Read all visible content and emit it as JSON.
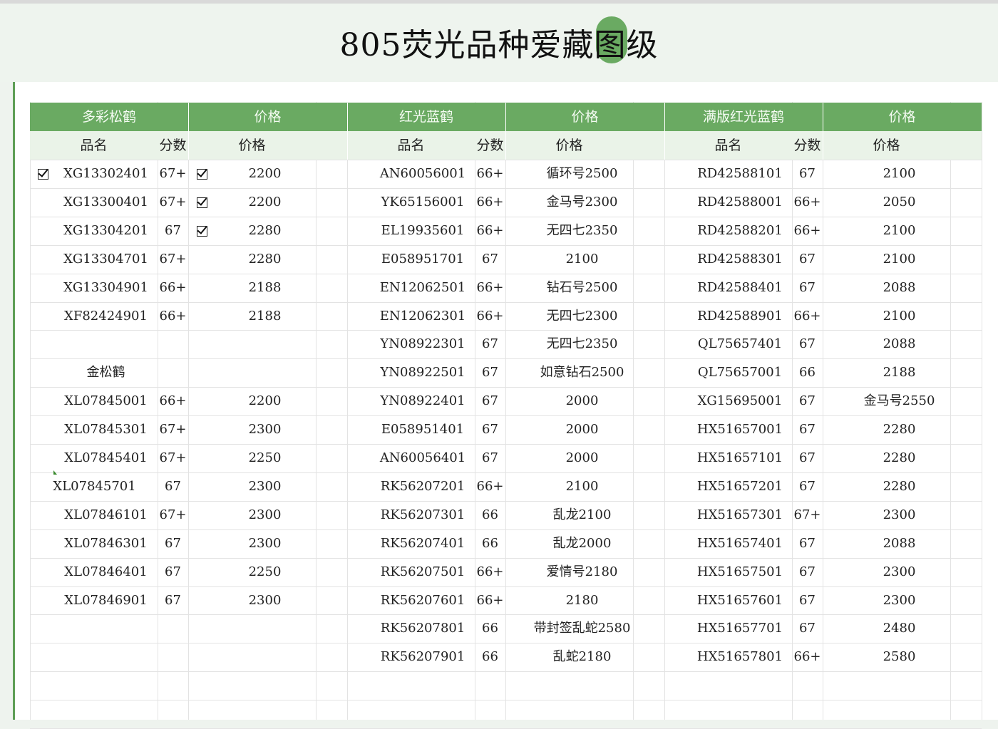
{
  "title": "805荧光品种爱藏图级",
  "groups": [
    {
      "name": "多彩松鹤",
      "price_header": "价格"
    },
    {
      "name": "红光蓝鹤",
      "price_header": "价格"
    },
    {
      "name": "满版红光蓝鹤",
      "price_header": "价格"
    }
  ],
  "subheaders": {
    "name": "品名",
    "score": "分数",
    "price": "价格"
  },
  "col1": [
    {
      "checked": true,
      "name": "XG13302401",
      "score": "67+",
      "pchecked": true,
      "price": "2200"
    },
    {
      "checked": false,
      "name": "XG13300401",
      "score": "67+",
      "pchecked": true,
      "price": "2200"
    },
    {
      "checked": false,
      "name": "XG13304201",
      "score": "67",
      "pchecked": true,
      "price": "2280"
    },
    {
      "checked": false,
      "name": "XG13304701",
      "score": "67+",
      "pchecked": false,
      "price": "2280"
    },
    {
      "checked": false,
      "name": "XG13304901",
      "score": "66+",
      "pchecked": false,
      "price": "2188"
    },
    {
      "checked": false,
      "name": "XF82424901",
      "score": "66+",
      "pchecked": false,
      "price": "2188"
    },
    {
      "checked": false,
      "name": "",
      "score": "",
      "pchecked": false,
      "price": ""
    },
    {
      "checked": false,
      "name": "金松鹤",
      "score": "",
      "pchecked": false,
      "price": ""
    },
    {
      "checked": false,
      "name": "XL07845001",
      "score": "66+",
      "pchecked": false,
      "price": "2200"
    },
    {
      "checked": false,
      "name": "XL07845301",
      "score": "67+",
      "pchecked": false,
      "price": "2300"
    },
    {
      "checked": false,
      "name": "XL07845401",
      "score": "67+",
      "pchecked": false,
      "price": "2250"
    },
    {
      "checked": false,
      "name": "XL07845701",
      "score": "67",
      "pchecked": false,
      "price": "2300"
    },
    {
      "checked": false,
      "name": "XL07846101",
      "score": "67+",
      "pchecked": false,
      "price": "2300"
    },
    {
      "checked": false,
      "name": "XL07846301",
      "score": "67",
      "pchecked": false,
      "price": "2300"
    },
    {
      "checked": false,
      "name": "XL07846401",
      "score": "67",
      "pchecked": false,
      "price": "2250"
    },
    {
      "checked": false,
      "name": "XL07846901",
      "score": "67",
      "pchecked": false,
      "price": "2300"
    }
  ],
  "col2": [
    {
      "name": "AN60056001",
      "score": "66+",
      "price": "循环号2500"
    },
    {
      "name": "YK65156001",
      "score": "66+",
      "price": "金马号2300"
    },
    {
      "name": "EL19935601",
      "score": "66+",
      "price": "无四七2350"
    },
    {
      "name": "E058951701",
      "score": "67",
      "price": "2100"
    },
    {
      "name": "EN12062501",
      "score": "66+",
      "price": "钻石号2500"
    },
    {
      "name": "EN12062301",
      "score": "66+",
      "price": "无四七2300"
    },
    {
      "name": "YN08922301",
      "score": "67",
      "price": "无四七2350"
    },
    {
      "name": "YN08922501",
      "score": "67",
      "price": "如意钻石2500"
    },
    {
      "name": "YN08922401",
      "score": "67",
      "price": "2000"
    },
    {
      "name": "E058951401",
      "score": "67",
      "price": "2000"
    },
    {
      "name": "AN60056401",
      "score": "67",
      "price": "2000"
    },
    {
      "name": "RK56207201",
      "score": "66+",
      "price": "2100"
    },
    {
      "name": "RK56207301",
      "score": "66",
      "price": "乱龙2100"
    },
    {
      "name": "RK56207401",
      "score": "66",
      "price": "乱龙2000"
    },
    {
      "name": "RK56207501",
      "score": "66+",
      "price": "爱情号2180"
    },
    {
      "name": "RK56207601",
      "score": "66+",
      "price": "2180"
    },
    {
      "name": "RK56207801",
      "score": "66",
      "price": "带封签乱蛇2580"
    },
    {
      "name": "RK56207901",
      "score": "66",
      "price": "乱蛇2180"
    }
  ],
  "col3": [
    {
      "name": "RD42588101",
      "score": "67",
      "price": "2100"
    },
    {
      "name": "RD42588001",
      "score": "66+",
      "price": "2050"
    },
    {
      "name": "RD42588201",
      "score": "66+",
      "price": "2100"
    },
    {
      "name": "RD42588301",
      "score": "67",
      "price": "2100"
    },
    {
      "name": "RD42588401",
      "score": "67",
      "price": "2088"
    },
    {
      "name": "RD42588901",
      "score": "66+",
      "price": "2100"
    },
    {
      "name": "QL75657401",
      "score": "67",
      "price": "2088"
    },
    {
      "name": "QL75657001",
      "score": "66",
      "price": "2188"
    },
    {
      "name": "XG15695001",
      "score": "67",
      "price": "金马号2550"
    },
    {
      "name": "HX51657001",
      "score": "67",
      "price": "2280"
    },
    {
      "name": "HX51657101",
      "score": "67",
      "price": "2280"
    },
    {
      "name": "HX51657201",
      "score": "67",
      "price": "2280"
    },
    {
      "name": "HX51657301",
      "score": "67+",
      "price": "2300"
    },
    {
      "name": "HX51657401",
      "score": "67",
      "price": "2088"
    },
    {
      "name": "HX51657501",
      "score": "67",
      "price": "2300"
    },
    {
      "name": "HX51657601",
      "score": "67",
      "price": "2300"
    },
    {
      "name": "HX51657701",
      "score": "67",
      "price": "2480"
    },
    {
      "name": "HX51657801",
      "score": "66+",
      "price": "2580"
    }
  ],
  "colors": {
    "header_green": "#6aaa62",
    "subheader_bg": "#eaf3e8",
    "page_bg": "#eef4ee"
  }
}
